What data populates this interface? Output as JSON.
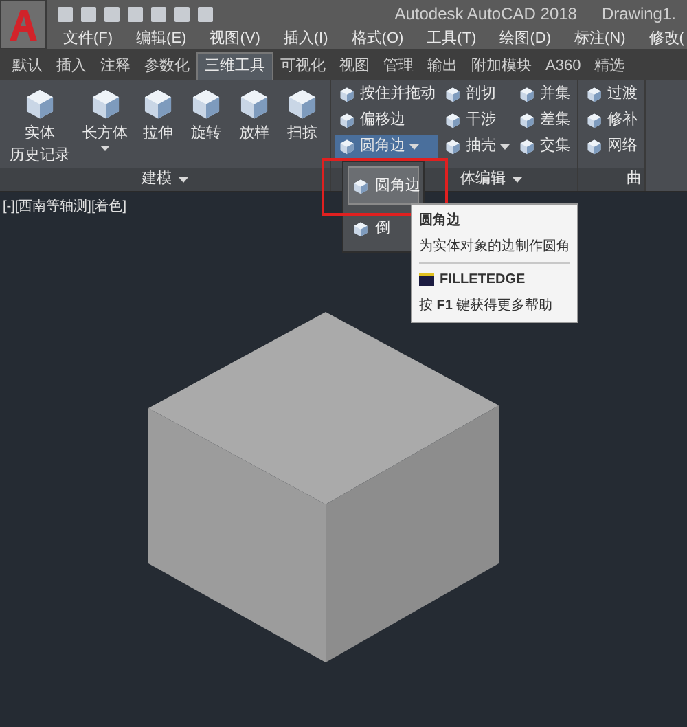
{
  "title_bar": {
    "app_title": "Autodesk AutoCAD 2018",
    "document_title": "Drawing1."
  },
  "menu_bar": [
    "文件(F)",
    "编辑(E)",
    "视图(V)",
    "插入(I)",
    "格式(O)",
    "工具(T)",
    "绘图(D)",
    "标注(N)",
    "修改("
  ],
  "ribbon_tabs": [
    {
      "label": "默认",
      "selected": false
    },
    {
      "label": "插入",
      "selected": false
    },
    {
      "label": "注释",
      "selected": false
    },
    {
      "label": "参数化",
      "selected": false
    },
    {
      "label": "三维工具",
      "selected": true
    },
    {
      "label": "可视化",
      "selected": false
    },
    {
      "label": "视图",
      "selected": false
    },
    {
      "label": "管理",
      "selected": false
    },
    {
      "label": "输出",
      "selected": false
    },
    {
      "label": "附加模块",
      "selected": false
    },
    {
      "label": "A360",
      "selected": false
    },
    {
      "label": "精选",
      "selected": false
    }
  ],
  "ribbon_panels": [
    {
      "title": "建模",
      "items": [
        {
          "label": [
            "实体",
            "历史记录"
          ],
          "kind": "large",
          "dropdown": false,
          "selected": false
        },
        {
          "label": "长方体",
          "kind": "large",
          "dropdown": true,
          "selected": false
        },
        {
          "label": "拉伸",
          "kind": "large",
          "dropdown": false,
          "selected": false
        },
        {
          "label": "旋转",
          "kind": "large",
          "dropdown": false,
          "selected": false
        },
        {
          "label": "放样",
          "kind": "large",
          "dropdown": false,
          "selected": false
        },
        {
          "label": "扫掠",
          "kind": "large",
          "dropdown": false,
          "selected": false
        }
      ]
    },
    {
      "title": "体编辑",
      "items": [
        {
          "label": "按住并拖动",
          "kind": "small",
          "dropdown": false,
          "selected": false
        },
        {
          "label": "偏移边",
          "kind": "small",
          "dropdown": false,
          "selected": false
        },
        {
          "label": "圆角边",
          "kind": "small",
          "dropdown": true,
          "selected": true
        },
        {
          "label": "剖切",
          "kind": "small",
          "dropdown": false,
          "selected": false
        },
        {
          "label": "干涉",
          "kind": "small",
          "dropdown": false,
          "selected": false
        },
        {
          "label": "抽壳",
          "kind": "small",
          "dropdown": true,
          "selected": false
        },
        {
          "label": "并集",
          "kind": "small",
          "dropdown": false,
          "selected": false
        },
        {
          "label": "差集",
          "kind": "small",
          "dropdown": false,
          "selected": false
        },
        {
          "label": "交集",
          "kind": "small",
          "dropdown": false,
          "selected": false
        }
      ]
    },
    {
      "title": "曲",
      "items": [
        {
          "label": "过渡",
          "kind": "small",
          "dropdown": false,
          "selected": false
        },
        {
          "label": "修补",
          "kind": "small",
          "dropdown": false,
          "selected": false
        },
        {
          "label": "网络",
          "kind": "small",
          "dropdown": false,
          "selected": false
        }
      ]
    }
  ],
  "viewport": {
    "label": "[-][西南等轴测][着色]"
  },
  "flyout": [
    {
      "label": "圆角边",
      "selected": true
    },
    {
      "label": "倒",
      "selected": false
    }
  ],
  "tooltip": {
    "title": "圆角边",
    "description": "为实体对象的边制作圆角",
    "command": "FILLETEDGE",
    "help": "按 **F1** 键获得更多帮助"
  }
}
